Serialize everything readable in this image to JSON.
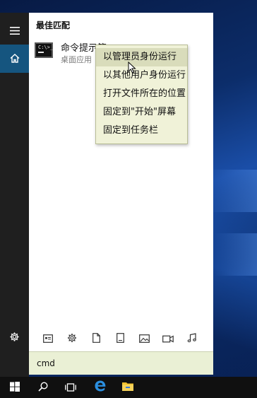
{
  "start_menu": {
    "section_title": "最佳匹配",
    "best_match": {
      "name": "命令提示符",
      "type": "桌面应用",
      "icon": "command-prompt-icon",
      "icon_text": "C:\\>_"
    },
    "rail": {
      "menu_icon": "hamburger-icon",
      "home_icon": "home-icon",
      "settings_icon": "gear-icon"
    },
    "filters": [
      {
        "icon": "apps-icon"
      },
      {
        "icon": "settings-filter-icon"
      },
      {
        "icon": "documents-icon"
      },
      {
        "icon": "folders-icon"
      },
      {
        "icon": "photos-icon"
      },
      {
        "icon": "videos-icon"
      },
      {
        "icon": "music-icon"
      }
    ]
  },
  "context_menu": {
    "items": [
      {
        "label": "以管理员身份运行",
        "highlighted": true
      },
      {
        "label": "以其他用户身份运行",
        "highlighted": false
      },
      {
        "label": "打开文件所在的位置",
        "highlighted": false
      },
      {
        "label": "固定到\"开始\"屏幕",
        "highlighted": false
      },
      {
        "label": "固定到任务栏",
        "highlighted": false
      }
    ]
  },
  "search": {
    "value": "cmd"
  },
  "taskbar": {
    "items": [
      {
        "icon": "windows-start-icon"
      },
      {
        "icon": "search-icon"
      },
      {
        "icon": "task-view-icon"
      },
      {
        "icon": "edge-icon"
      },
      {
        "icon": "file-explorer-icon"
      }
    ]
  },
  "colors": {
    "rail_bg": "#1f1f1f",
    "rail_active": "#15557f",
    "context_menu_bg": "#f0f2d8",
    "taskbar_bg": "#101010"
  }
}
